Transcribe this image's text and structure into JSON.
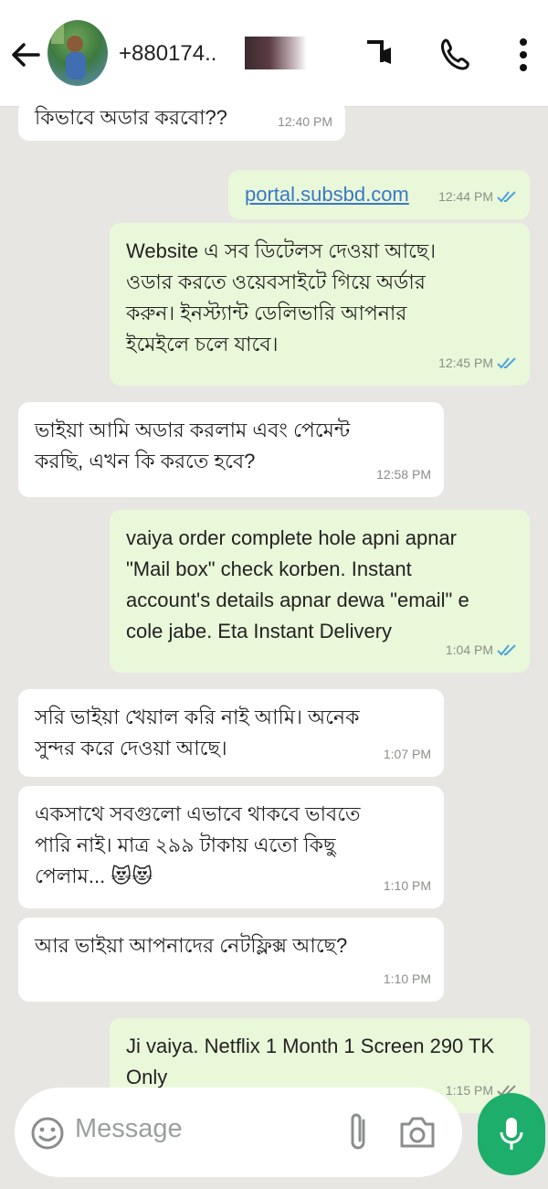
{
  "header": {
    "contact": "+880174..",
    "icons": [
      "back-arrow-icon",
      "video-call-icon",
      "phone-icon",
      "more-vertical-icon"
    ]
  },
  "messages": [
    {
      "dir": "in",
      "text": "কিভাবে অডার করবো??",
      "time": "12:40 PM"
    },
    {
      "dir": "out",
      "text": "portal.subsbd.com",
      "time": "12:44 PM",
      "link": true
    },
    {
      "dir": "out",
      "text": "Website এ সব ডিটেলস দেওয়া আছে।\nওডার করতে ওয়েবসাইটে গিয়ে অর্ডার\nকরুন। ইনস্ট্যান্ট ডেলিভারি আপনার\nইমেইলে চলে যাবে।",
      "time": "12:45 PM"
    },
    {
      "dir": "in",
      "text": "ভাইয়া আমি অডার করলাম এবং পেমেন্ট\nকরছি, এখন কি করতে হবে?",
      "time": "12:58 PM"
    },
    {
      "dir": "out",
      "text": "vaiya order complete hole apni apnar\n\"Mail box\" check korben. Instant\naccount's details apnar dewa \"email\" e\ncole jabe. Eta Instant Delivery",
      "time": "1:04 PM"
    },
    {
      "dir": "in",
      "text": "সরি ভাইয়া খেয়াল করি নাই আমি। অনেক\nসুন্দর করে দেওয়া আছে।",
      "time": "1:07 PM"
    },
    {
      "dir": "in",
      "text": "একসাথে সবগুলো এভাবে থাকবে ভাবতে\nপারি নাই। মাত্র ২৯৯ টাকায় এতো কিছু\nপেলাম... 😻😻",
      "time": "1:10 PM"
    },
    {
      "dir": "in",
      "text": "আর ভাইয়া আপনাদের নেটফ্লিক্স আছে?",
      "time": "1:10 PM"
    },
    {
      "dir": "out",
      "text": "Ji vaiya. Netflix 1 Month 1 Screen 290 TK\nOnly",
      "time": "1:15 PM"
    }
  ],
  "input": {
    "placeholder": "Message"
  },
  "colors": {
    "incoming": "#ffffff",
    "outgoing": "#eaf8da",
    "background": "#e7e6e2",
    "accent": "#1cae6a",
    "tick": "#4aa3df"
  }
}
